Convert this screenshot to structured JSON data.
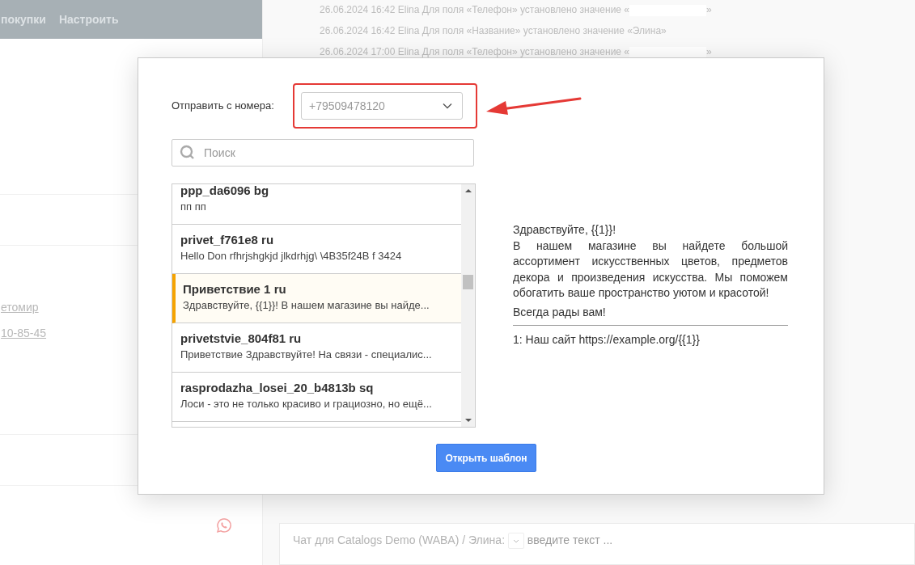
{
  "header": {
    "menu_items": [
      "покупки",
      "Настроить"
    ]
  },
  "history": [
    {
      "date": "26.06.2024 16:42",
      "user": "Elina",
      "text": "Для поля «Телефон» установлено значение «",
      "redacted": true,
      "suffix": "»"
    },
    {
      "date": "26.06.2024 16:42",
      "user": "Elina",
      "text": "Для поля «Название» установлено значение «Элина»",
      "redacted": false
    },
    {
      "date": "26.06.2024 17:00",
      "user": "Elina",
      "text": "Для поля «Телефон» установлено значение «",
      "redacted": true,
      "suffix": "»"
    }
  ],
  "contact": {
    "links": [
      "етомир",
      "10-85-45"
    ]
  },
  "modal": {
    "sender_label": "Отправить с номера:",
    "sender_value": "+79509478120",
    "highlighted": true,
    "search_placeholder": "Поиск",
    "templates": [
      {
        "name": "ppp_da6096 bg",
        "preview": "пп пп",
        "selected": false
      },
      {
        "name": "privet_f761e8 ru",
        "preview": "Hello Don rfhrjshgkjd jlkdrhjg\\ \\4B35f24B f 3424",
        "selected": false
      },
      {
        "name": "Приветствие 1 ru",
        "preview": "Здравствуйте, {{1}}! В нашем магазине вы найде...",
        "selected": true
      },
      {
        "name": "privetstvie_804f81 ru",
        "preview": "Приветствие Здравствуйте! На связи - специалис...",
        "selected": false
      },
      {
        "name": "rasprodazha_losei_20_b4813b sq",
        "preview": "Лоси - это не только красиво и грациозно, но ещё...",
        "selected": false
      }
    ],
    "preview": {
      "greeting": "Здравствуйте, {{1}}!",
      "body": "В нашем магазине вы найдете большой ассортимент искусственных цветов, предметов декора и произведения искусства. Мы поможем обогатить ваше пространство уютом и красотой!",
      "closing": "Всегда рады вам!",
      "buttons": [
        "1: Наш сайт https://example.org/{{1}}"
      ]
    },
    "open_button": "Открыть шаблон"
  },
  "chat_bar": {
    "chat_link": "Чат",
    "for_text": "для",
    "contact_link": "Catalogs Demo (WABA) / Элина",
    "colon": ":",
    "placeholder": "введите текст ..."
  }
}
